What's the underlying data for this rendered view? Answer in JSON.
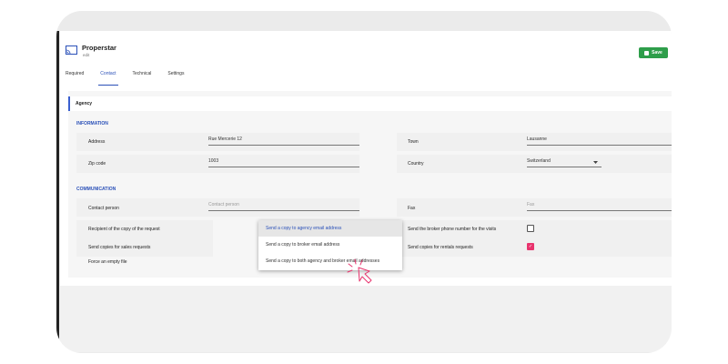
{
  "app": {
    "title": "Properstar",
    "subtitle": "edit",
    "save_label": "Save"
  },
  "tabs": [
    {
      "label": "Required",
      "active": false
    },
    {
      "label": "Contact",
      "active": true
    },
    {
      "label": "Technical",
      "active": false
    },
    {
      "label": "Settings",
      "active": false
    }
  ],
  "agency": {
    "label": "Agency"
  },
  "information": {
    "title": "INFORMATION",
    "address_label": "Address",
    "address_value": "Rue Mercerie 12",
    "town_label": "Town",
    "town_value": "Lausanne",
    "zip_label": "Zip code",
    "zip_value": "1003",
    "country_label": "Country",
    "country_value": "Switzerland"
  },
  "communication": {
    "title": "COMMUNICATION",
    "contact_label": "Contact person",
    "contact_placeholder": "Contact person",
    "fax_label": "Fax",
    "fax_placeholder": "Fax",
    "recipient_label": "Recipient of the copy of the request",
    "phone_label": "Send the broker phone number for the visits",
    "phone_checked": false,
    "sales_label": "Send copies for sales requests",
    "rentals_label": "Send copies for rentals requests",
    "rentals_checked": true,
    "force_label": "Force an empty file"
  },
  "dropdown": {
    "options": [
      "Send a copy to agency email address",
      "Send a copy to broker email address",
      "Send a copy to both agency and broker email addresses"
    ],
    "selected_index": 0
  },
  "colors": {
    "accent": "#2a50b8",
    "save": "#2e9e4a",
    "cursor": "#e8336d"
  }
}
